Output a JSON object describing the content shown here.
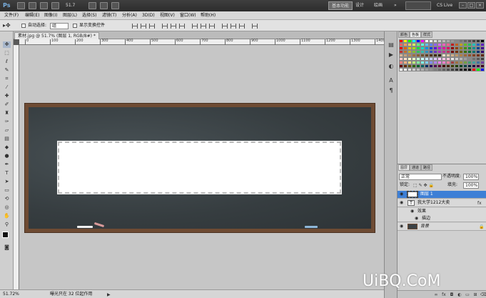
{
  "topbar": {
    "logo": "Ps",
    "zoom": "51.7",
    "workspaces": [
      "基本功能",
      "设计",
      "绘画"
    ],
    "cs_live": "CS Live"
  },
  "menu": [
    "文件(F)",
    "编辑(E)",
    "图像(I)",
    "图层(L)",
    "选择(S)",
    "滤镜(T)",
    "分析(A)",
    "3D(D)",
    "视图(V)",
    "窗口(W)",
    "帮助(H)"
  ],
  "options": {
    "auto_select_label": "自动选择:",
    "auto_select_value": "组",
    "show_transform_label": "显示变换控件"
  },
  "document": {
    "tab_title": "素材.jpg @ 51.7% (图层 1, RGB/8#) *",
    "ruler_numbers": [
      "0",
      "100",
      "200",
      "300",
      "400",
      "500",
      "600",
      "700",
      "800",
      "900",
      "1000",
      "1100",
      "1200",
      "1300",
      "1400"
    ]
  },
  "status": {
    "zoom": "51.72%",
    "message": "曝光只在 32 位起作用"
  },
  "swatches": {
    "tabs": [
      "颜色",
      "色板",
      "样式"
    ],
    "colors": [
      "#ff0000",
      "#ffff00",
      "#00ff00",
      "#00ffff",
      "#0000ff",
      "#ff00ff",
      "#ffffff",
      "#eeeeee",
      "#dddddd",
      "#cccccc",
      "#bbbbbb",
      "#aaaaaa",
      "#999999",
      "#888888",
      "#777777",
      "#666666",
      "#555555",
      "#444444",
      "#333333",
      "#000000",
      "#ff6060",
      "#ff9c60",
      "#ffd060",
      "#d8ff60",
      "#60ff80",
      "#60ffe0",
      "#60c0ff",
      "#6080ff",
      "#9060ff",
      "#e060ff",
      "#ff60c0",
      "#ff6090",
      "#c02020",
      "#c06020",
      "#c0a020",
      "#60c020",
      "#20c060",
      "#20c0c0",
      "#2060c0",
      "#6020c0",
      "#e00000",
      "#e06000",
      "#e0c000",
      "#a0e000",
      "#00e040",
      "#00e0c0",
      "#0090e0",
      "#0040e0",
      "#6000e0",
      "#c000e0",
      "#e000a0",
      "#e00060",
      "#900000",
      "#904000",
      "#908000",
      "#409000",
      "#009040",
      "#009090",
      "#004090",
      "#400090",
      "#c03030",
      "#c07030",
      "#c0b030",
      "#80c030",
      "#30c060",
      "#30c0b0",
      "#3090c0",
      "#3050c0",
      "#7030c0",
      "#b030c0",
      "#c03090",
      "#c03060",
      "#700000",
      "#703000",
      "#706000",
      "#307000",
      "#007030",
      "#007070",
      "#003070",
      "#300070",
      "#d8b898",
      "#c8a078",
      "#b88858",
      "#a07040",
      "#886030",
      "#705028",
      "#604020",
      "#503018",
      "#402810",
      "#302008",
      "#f0e0c8",
      "#e0c8a8",
      "#d0b088",
      "#c09868",
      "#b08048",
      "#a06838",
      "#905028",
      "#804020",
      "#703018",
      "#602810",
      "#ffc8c8",
      "#ffe0c8",
      "#fff8c8",
      "#e8ffc8",
      "#c8ffd8",
      "#c8fff8",
      "#c8e8ff",
      "#c8d0ff",
      "#e0c8ff",
      "#f8c8ff",
      "#ffc8e8",
      "#ffc8d8",
      "#e8e8e8",
      "#d0d0d0",
      "#b8b8b8",
      "#a0a0a0",
      "#888888",
      "#707070",
      "#585858",
      "#404040",
      "#ff8080",
      "#ffb080",
      "#ffe080",
      "#c0ff80",
      "#80ffa0",
      "#80ffe8",
      "#80d0ff",
      "#8090ff",
      "#b080ff",
      "#f080ff",
      "#ff80d0",
      "#ff80a0",
      "#a04040",
      "#a07040",
      "#a09040",
      "#70a040",
      "#40a070",
      "#40a0a0",
      "#4070a0",
      "#7040a0",
      "#600000",
      "#602800",
      "#605000",
      "#286000",
      "#006028",
      "#006060",
      "#002860",
      "#280060",
      "#500050",
      "#600030",
      "#400000",
      "#402000",
      "#404000",
      "#204000",
      "#004020",
      "#004040",
      "#002040",
      "#200040",
      "#400040",
      "#400020",
      "#ffffff",
      "#f0f0f0",
      "#e0e0e0",
      "#d0d0d0",
      "#c0c0c0",
      "#b0b0b0",
      "#a0a0a0",
      "#909090",
      "#808080",
      "#707070",
      "#606060",
      "#505050",
      "#404040",
      "#303030",
      "#202020",
      "#101010",
      "#000000",
      "#ff0000",
      "#00ff00",
      "#0000ff"
    ]
  },
  "layers": {
    "tabs": [
      "图层",
      "通道",
      "路径"
    ],
    "blend_mode": "正常",
    "opacity_label": "不透明度:",
    "opacity_value": "100%",
    "lock_label": "锁定:",
    "fill_label": "填充:",
    "fill_value": "100%",
    "rows": [
      {
        "name": "图层 1",
        "selected": true
      },
      {
        "name": "我大学1212大卖",
        "selected": false
      },
      {
        "name": "效果",
        "selected": false
      },
      {
        "name": "描边",
        "selected": false
      },
      {
        "name": "背景",
        "selected": false
      }
    ]
  },
  "watermark": "UiBQ.CoM"
}
